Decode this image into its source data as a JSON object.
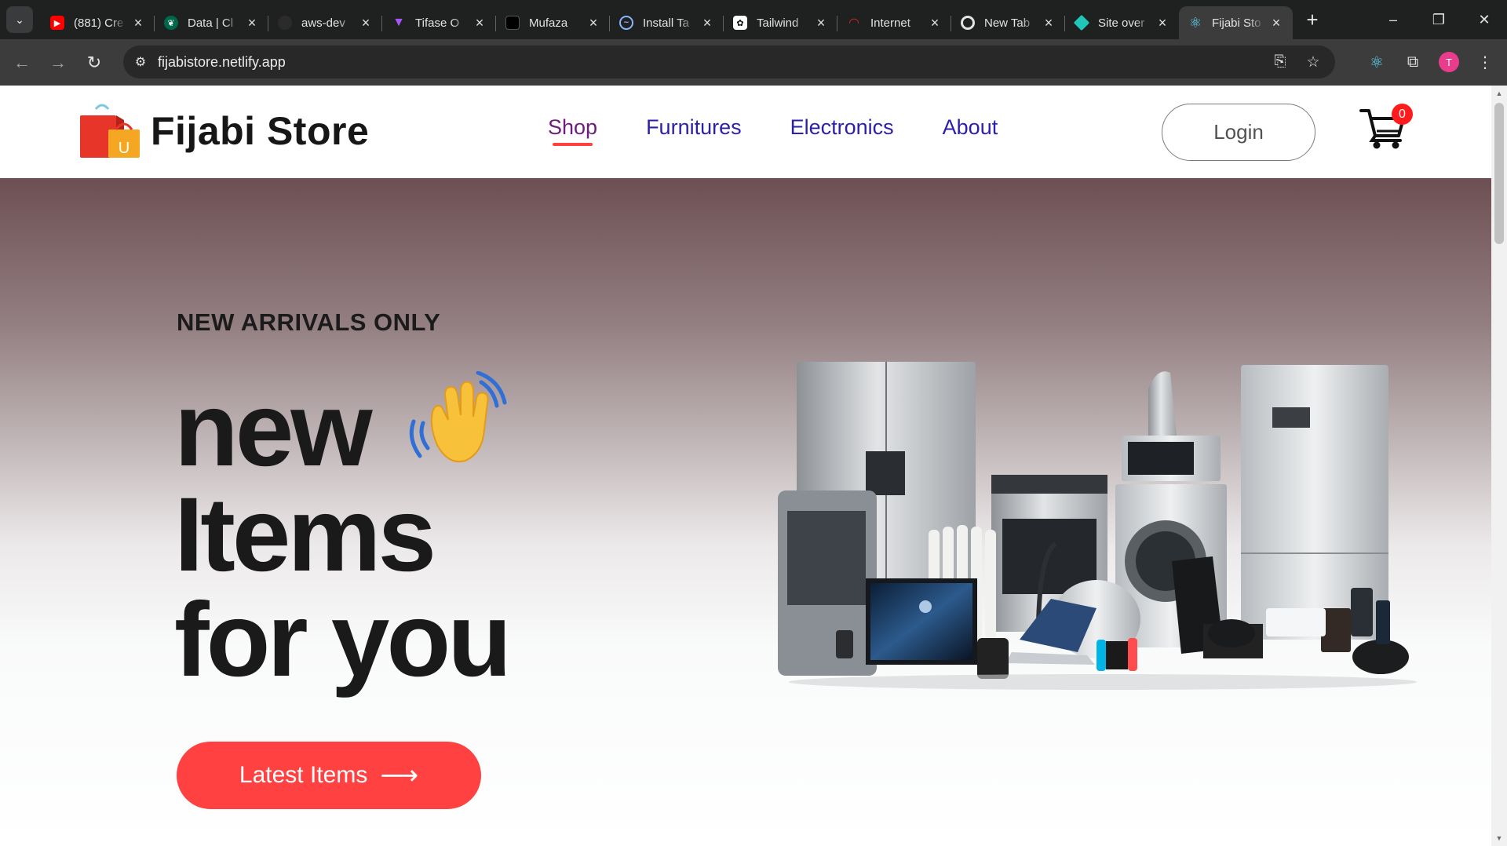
{
  "browser": {
    "tabs": [
      {
        "title": "(881) Cre",
        "icon": "youtube-icon",
        "color": "#ff0000"
      },
      {
        "title": "Data | Cl",
        "icon": "mongodb-icon",
        "color": "#00ed64"
      },
      {
        "title": "aws-dev",
        "icon": "github-icon",
        "color": "#444444"
      },
      {
        "title": "Tifase O",
        "icon": "vite-icon",
        "color": "#a855f7"
      },
      {
        "title": "Mufaza",
        "icon": "site-icon",
        "color": "#000000"
      },
      {
        "title": "Install Ta",
        "icon": "tailwind-icon",
        "color": "#38bdf8"
      },
      {
        "title": "Tailwind",
        "icon": "chatgpt-icon",
        "color": "#ffffff"
      },
      {
        "title": "Internet",
        "icon": "speedtest-icon",
        "color": "#c62828"
      },
      {
        "title": "New Tab",
        "icon": "chrome-icon",
        "color": "#ffffff"
      },
      {
        "title": "Site over",
        "icon": "netlify-icon",
        "color": "#20c6b7"
      },
      {
        "title": "Fijabi Sto",
        "icon": "react-icon",
        "color": "#61dafb"
      }
    ],
    "active_tab_index": 10,
    "url": "fijabistore.netlify.app",
    "avatar_letter": "T"
  },
  "site": {
    "brand": "Fijabi Store",
    "logo_letter": "U",
    "nav": [
      "Shop",
      "Furnitures",
      "Electronics",
      "About"
    ],
    "login_label": "Login",
    "cart_count": "0"
  },
  "hero": {
    "eyebrow": "NEW ARRIVALS ONLY",
    "line1": "new",
    "line2": "Items",
    "line3": "for you",
    "cta_label": "Latest Items",
    "cta_arrow": "⟶"
  },
  "colors": {
    "accent": "#ff4141",
    "nav_link": "#2c1fae",
    "nav_active": "#6e1c7e"
  }
}
